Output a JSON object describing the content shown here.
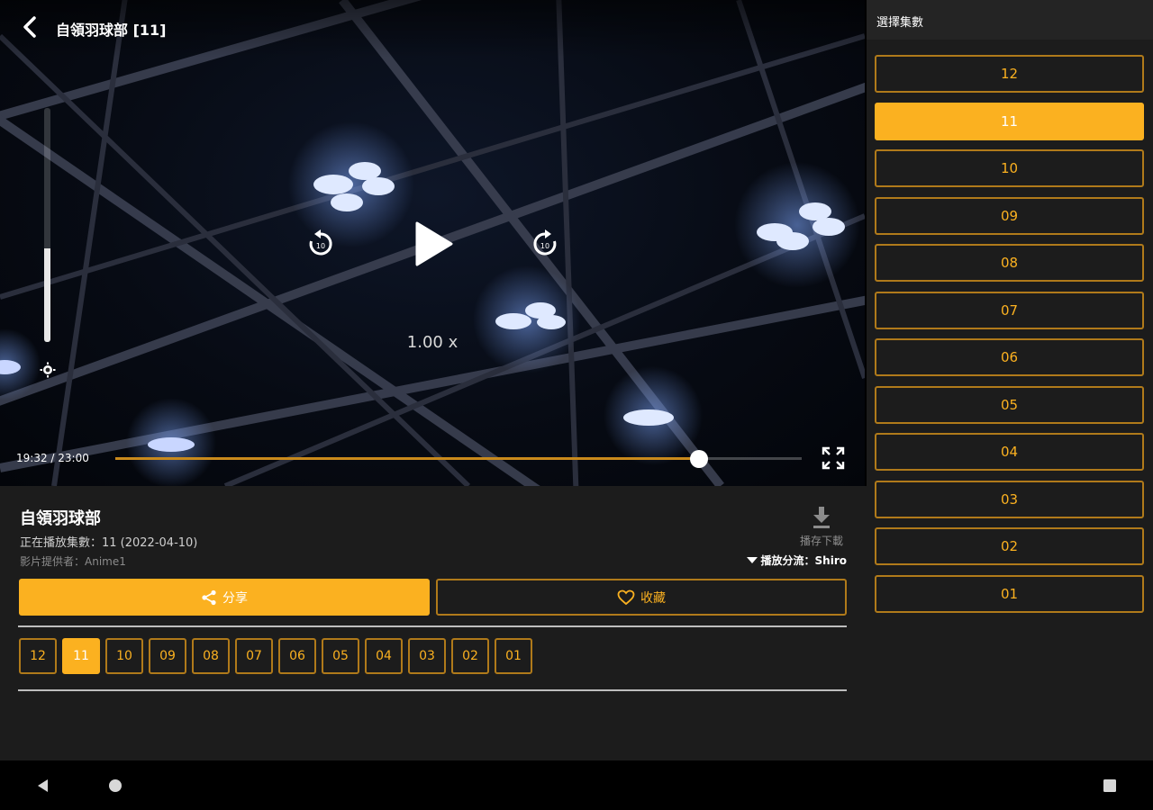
{
  "player": {
    "title": "自領羽球部 [11]",
    "current_time": "19:32",
    "duration": "23:00",
    "time_text": "19:32 / 23:00",
    "progress_fraction": 0.85,
    "brightness_fraction": 0.4,
    "speed": "1.00 x"
  },
  "info": {
    "title": "自領羽球部",
    "now_playing": "正在播放集數：11 (2022-04-10)",
    "provider": "影片提供者：Anime1",
    "download_label": "播存下載",
    "source_label": "播放分流：Shiro",
    "share_label": "分享",
    "favorite_label": "收藏"
  },
  "episodes": [
    "12",
    "11",
    "10",
    "09",
    "08",
    "07",
    "06",
    "05",
    "04",
    "03",
    "02",
    "01"
  ],
  "active_episode": "11",
  "panel": {
    "title": "選擇集數"
  },
  "colors": {
    "accent": "#fbb120",
    "border": "#b07a1a",
    "background": "#1c1c1c"
  }
}
